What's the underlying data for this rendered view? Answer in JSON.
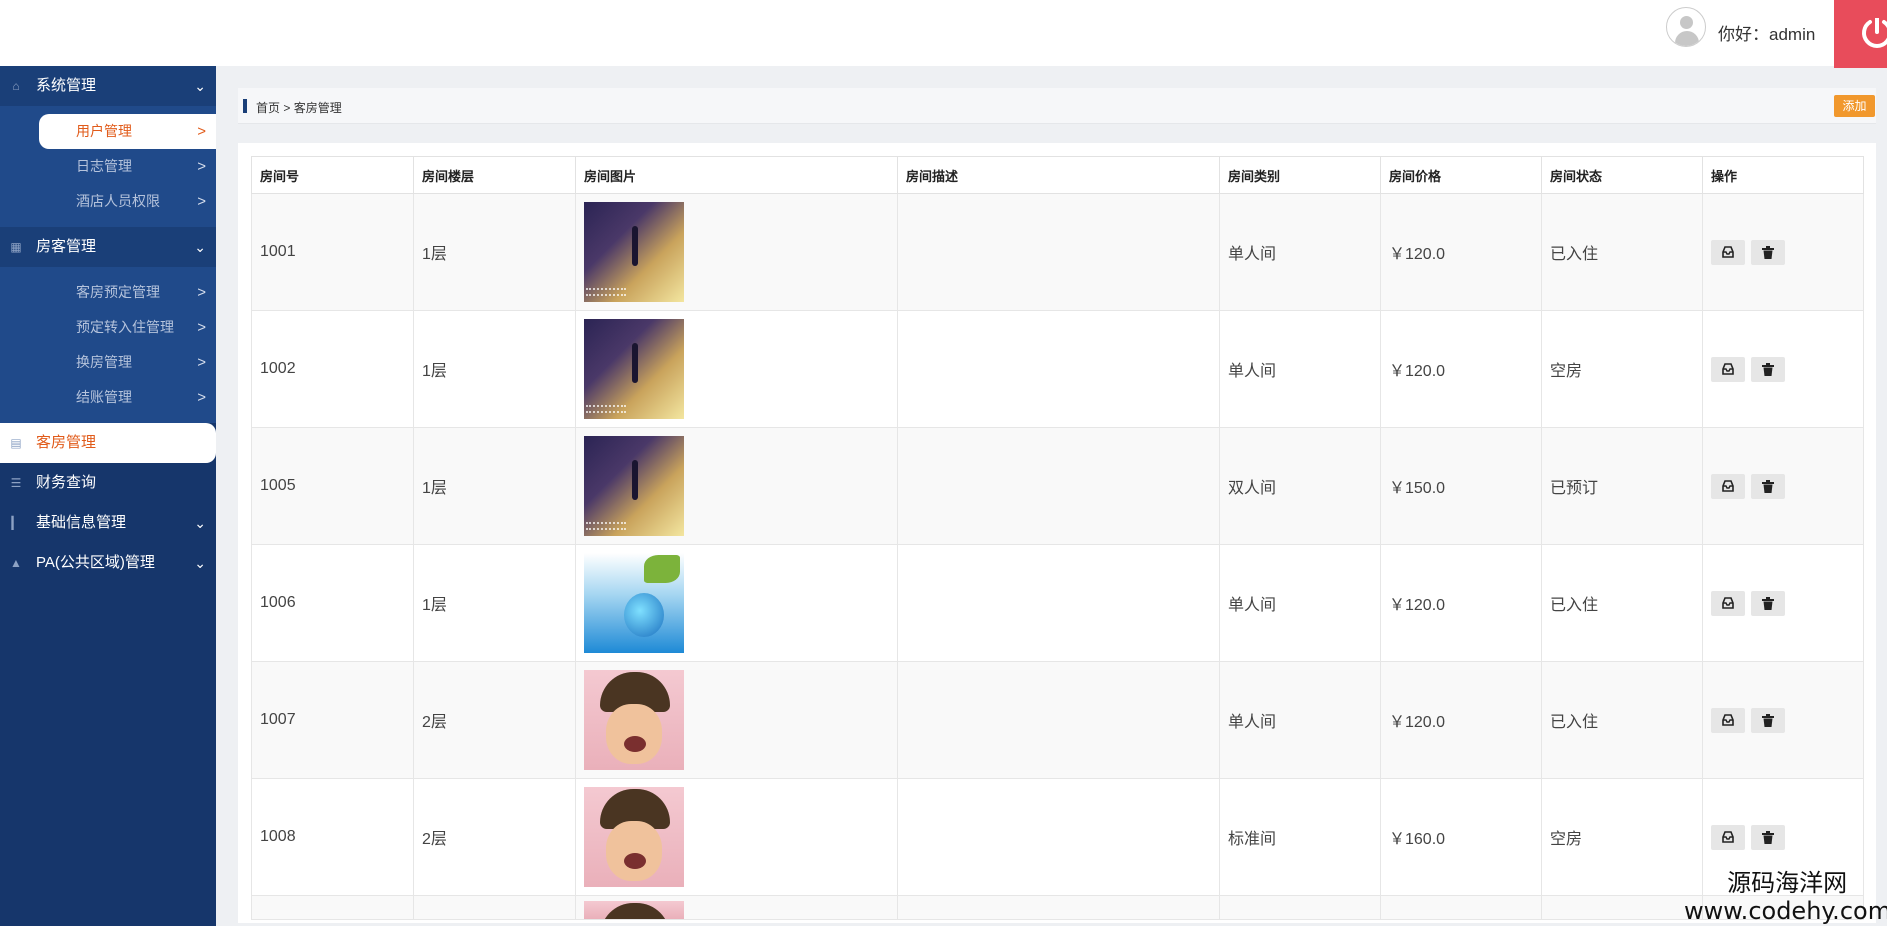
{
  "header": {
    "greeting": "你好：admin",
    "logout_icon": "power-icon"
  },
  "sidebar": {
    "groups": [
      {
        "label": "系统管理",
        "icon": "home-icon",
        "items": [
          {
            "label": "用户管理",
            "active": true
          },
          {
            "label": "日志管理"
          },
          {
            "label": "酒店人员权限"
          }
        ]
      },
      {
        "label": "房客管理",
        "icon": "grid-icon",
        "items": [
          {
            "label": "客房预定管理"
          },
          {
            "label": "预定转入住管理"
          },
          {
            "label": "换房管理"
          },
          {
            "label": "结账管理"
          }
        ]
      }
    ],
    "singles": [
      {
        "label": "客房管理",
        "icon": "calendar-icon",
        "active": true
      },
      {
        "label": "财务查询",
        "icon": "list-icon"
      },
      {
        "label": "基础信息管理",
        "icon": "signal-icon"
      },
      {
        "label": "PA(公共区域)管理",
        "icon": "warning-icon"
      }
    ],
    "arrow": ">",
    "chevron": "⌄"
  },
  "breadcrumb": {
    "home": "首页",
    "sep": ">",
    "current": "客房管理"
  },
  "toolbar": {
    "add_label": "添加"
  },
  "table": {
    "headers": [
      "房间号",
      "房间楼层",
      "房间图片",
      "房间描述",
      "房间类别",
      "房间价格",
      "房间状态",
      "操作"
    ],
    "rows": [
      {
        "no": "1001",
        "floor": "1层",
        "image": "street",
        "desc": "",
        "type": "单人间",
        "price": "￥120.0",
        "status": "已入住"
      },
      {
        "no": "1002",
        "floor": "1层",
        "image": "street",
        "desc": "",
        "type": "单人间",
        "price": "￥120.0",
        "status": "空房"
      },
      {
        "no": "1005",
        "floor": "1层",
        "image": "street",
        "desc": "",
        "type": "双人间",
        "price": "￥150.0",
        "status": "已预订"
      },
      {
        "no": "1006",
        "floor": "1层",
        "image": "sea",
        "desc": "",
        "type": "单人间",
        "price": "￥120.0",
        "status": "已入住"
      },
      {
        "no": "1007",
        "floor": "2层",
        "image": "baby",
        "desc": "",
        "type": "单人间",
        "price": "￥120.0",
        "status": "已入住"
      },
      {
        "no": "1008",
        "floor": "2层",
        "image": "baby",
        "desc": "",
        "type": "标准间",
        "price": "￥160.0",
        "status": "空房"
      }
    ],
    "partial_row_image": "baby",
    "actions": {
      "edit_icon": "inbox-icon",
      "delete_icon": "trash-icon"
    }
  },
  "watermark": {
    "line1": "源码海洋网",
    "line2": "www.codehy.com"
  }
}
